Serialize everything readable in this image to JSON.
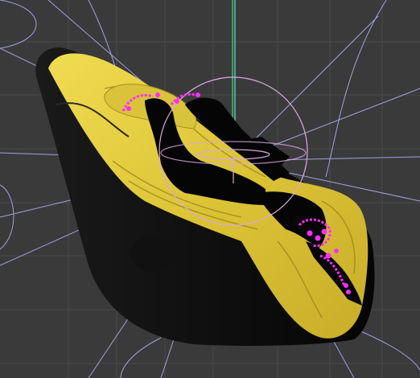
{
  "viewport": {
    "name": "3d-viewport",
    "background": "#3a3a3a",
    "grid_color": "#4a4a4a",
    "guide_color": "#b4b4ff",
    "gizmo_color": "#d8a8e0",
    "selection_color": "#ff2cff",
    "axis_green": "#2ecc71",
    "axis_cyan": "#7fffff"
  },
  "object": {
    "name": "car-seat-model",
    "shell_color": "#0a0a0a",
    "cushion_color": "#e3cf3c",
    "cushion_shadow": "#b49a1c",
    "strap_color": "#050505"
  },
  "icons": {
    "rotate_gizmo": "rotate-gizmo-icon",
    "pivot": "pivot-icon",
    "selected_vertices": "selected-vertices-icon"
  }
}
